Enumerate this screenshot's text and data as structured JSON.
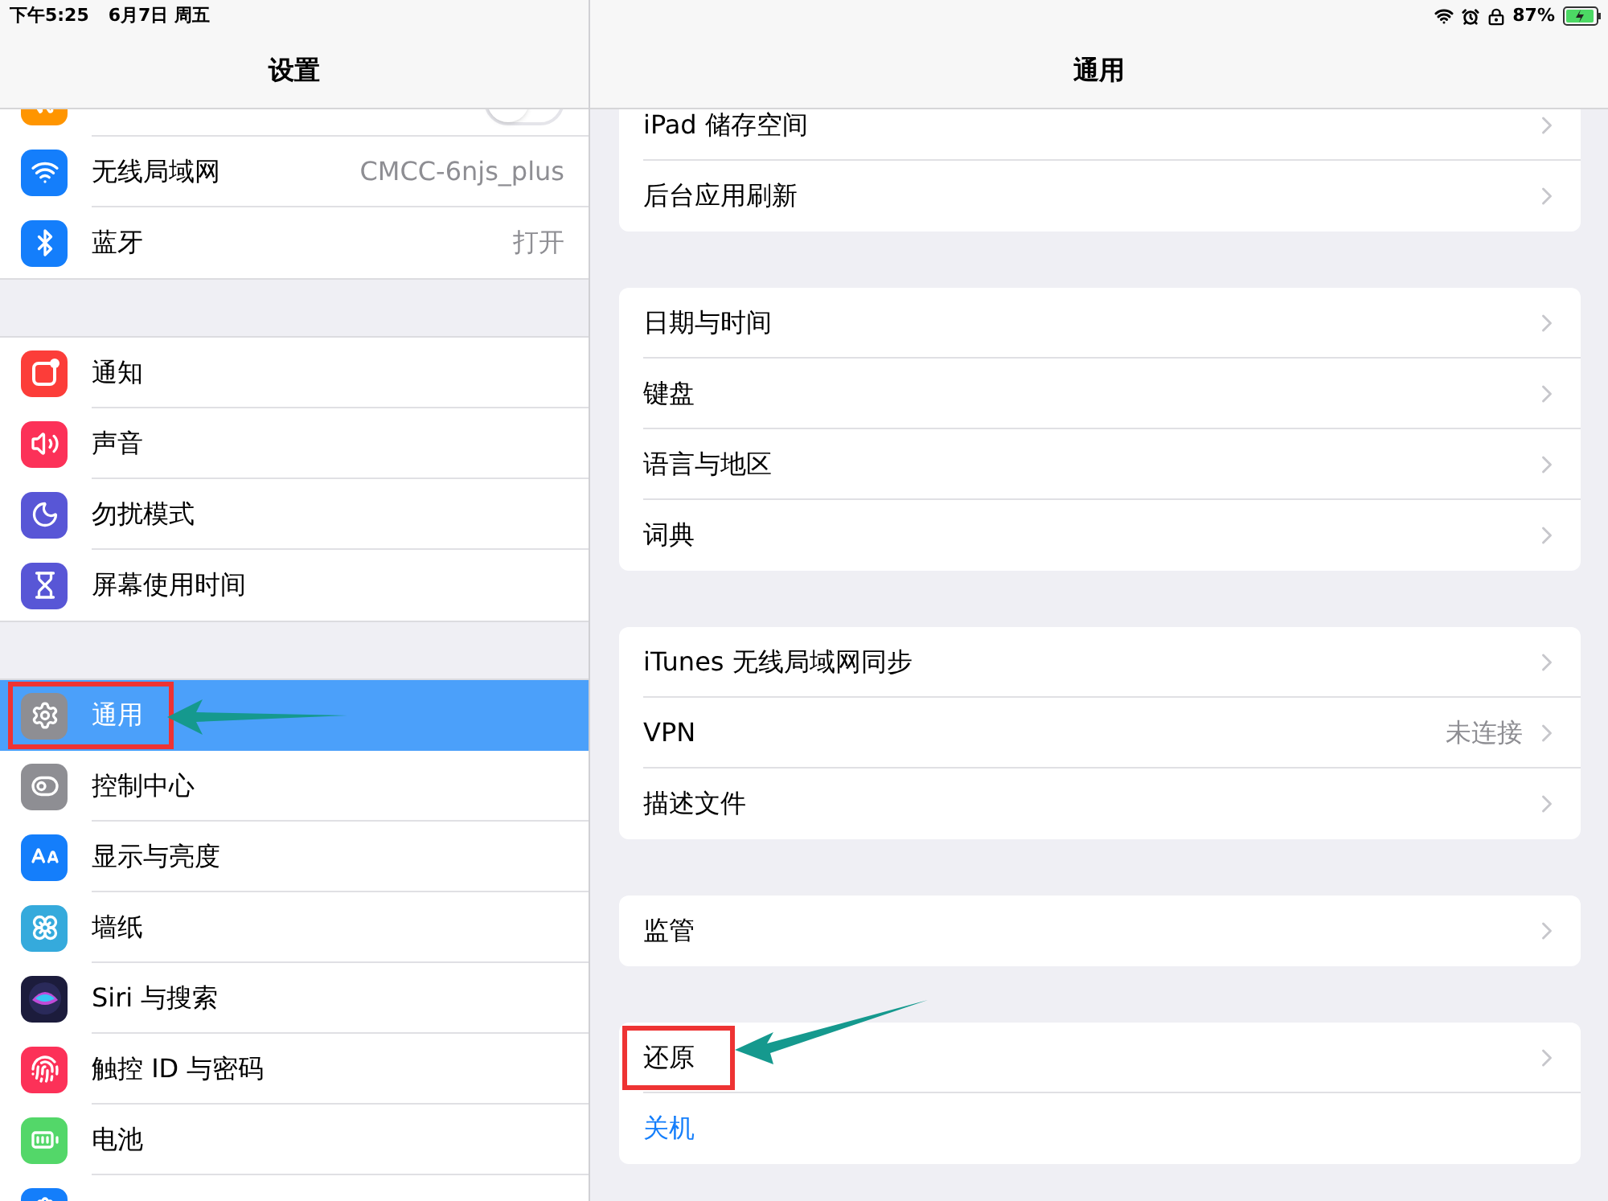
{
  "status_bar": {
    "time": "下午5:25",
    "date": "6月7日 周五",
    "battery": "87%"
  },
  "settings": {
    "title": "设置",
    "groups": [
      [
        {
          "kind": "toggle",
          "on": false,
          "color": "#ff9500",
          "selected": false,
          "marked": false
        },
        {
          "kind": "link",
          "label": "无线局域网",
          "value": "CMCC-6njs_plus",
          "color": "#147efb",
          "selected": false,
          "marked": false
        },
        {
          "kind": "link",
          "label": "蓝牙",
          "value": "打开",
          "color": "#147efb",
          "selected": false,
          "marked": false
        }
      ],
      [
        {
          "kind": "link",
          "label": "通知",
          "color": "#fc3d39",
          "selected": false,
          "marked": false
        },
        {
          "kind": "link",
          "label": "声音",
          "color": "#fc3158",
          "selected": false,
          "marked": false
        },
        {
          "kind": "link",
          "label": "勿扰模式",
          "color": "#5856d6",
          "selected": false,
          "marked": false
        },
        {
          "kind": "link",
          "label": "屏幕使用时间",
          "color": "#5856d6",
          "selected": false,
          "marked": false
        }
      ],
      [
        {
          "kind": "link",
          "label": "通用",
          "color": "#8e8e93",
          "selected": true,
          "marked": true
        },
        {
          "kind": "link",
          "label": "控制中心",
          "color": "#8e8e93",
          "selected": false,
          "marked": false
        },
        {
          "kind": "link",
          "label": "显示与亮度",
          "color": "#147efb",
          "selected": false,
          "marked": false
        },
        {
          "kind": "link",
          "label": "墙纸",
          "color": "#35aadc",
          "selected": false,
          "marked": false
        },
        {
          "kind": "link",
          "label": "Siri 与搜索",
          "color": "#1c1c3c",
          "selected": false,
          "marked": false
        },
        {
          "kind": "link",
          "label": "触控 ID 与密码",
          "color": "#fc3158",
          "selected": false,
          "marked": false
        },
        {
          "kind": "link",
          "label": "电池",
          "color": "#53d769",
          "selected": false,
          "marked": false
        },
        {
          "kind": "link",
          "color": "#147efb",
          "selected": false,
          "marked": false
        }
      ]
    ]
  },
  "general": {
    "title": "通用",
    "groups": [
      [
        {
          "kind": "link",
          "label": "iPad 储存空间",
          "marked": false
        },
        {
          "kind": "link",
          "label": "后台应用刷新",
          "marked": false
        }
      ],
      [
        {
          "kind": "link",
          "label": "日期与时间",
          "marked": false
        },
        {
          "kind": "link",
          "label": "键盘",
          "marked": false
        },
        {
          "kind": "link",
          "label": "语言与地区",
          "marked": false
        },
        {
          "kind": "link",
          "label": "词典",
          "marked": false
        }
      ],
      [
        {
          "kind": "link",
          "label": "iTunes 无线局域网同步",
          "marked": false
        },
        {
          "kind": "link",
          "label": "VPN",
          "value": "未连接",
          "marked": false
        },
        {
          "kind": "link",
          "label": "描述文件",
          "marked": false
        }
      ],
      [
        {
          "kind": "link",
          "label": "监管",
          "marked": false
        }
      ],
      [
        {
          "kind": "link",
          "label": "还原",
          "marked": true
        },
        {
          "kind": "action",
          "label": "关机",
          "marked": false
        }
      ]
    ]
  }
}
